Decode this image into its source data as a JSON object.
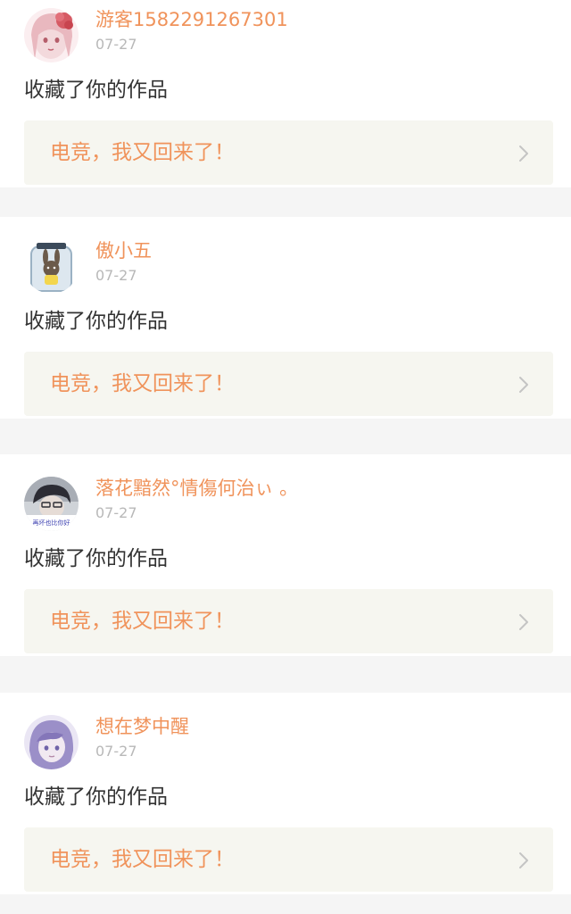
{
  "notifications": [
    {
      "username": "游客1582291267301",
      "date": "07-27",
      "action": "收藏了你的作品",
      "work_title": "电竞，我又回来了！",
      "avatar_icon": "anime-girl-red-flower-avatar-icon",
      "avatar_colors": [
        "#f3d9dc",
        "#d65a64",
        "#fbeef0"
      ]
    },
    {
      "username": "傲小五",
      "date": "07-27",
      "action": "收藏了你的作品",
      "work_title": "电竞，我又回来了！",
      "avatar_icon": "bunny-in-jar-avatar-icon",
      "avatar_colors": [
        "#dde7ef",
        "#6b5a4a",
        "#f3d64d"
      ]
    },
    {
      "username": "落花黯然°情傷何治ぃ 。",
      "date": "07-27",
      "action": "收藏了你的作品",
      "work_title": "电竞，我又回来了！",
      "avatar_icon": "boy-with-caption-avatar-icon",
      "avatar_colors": [
        "#cfd3d8",
        "#2c2c34",
        "#3b3fb0"
      ],
      "avatar_caption": "再坏也比你好"
    },
    {
      "username": "想在梦中醒",
      "date": "07-27",
      "action": "收藏了你的作品",
      "work_title": "电竞，我又回来了！",
      "avatar_icon": "purple-haired-girl-avatar-icon",
      "avatar_colors": [
        "#c9c3e3",
        "#9b8fc8",
        "#eae6f4"
      ]
    }
  ],
  "colors": {
    "accent": "#f0935b",
    "background": "#f5f5f5",
    "card": "#ffffff",
    "work_box": "#f6f6f0",
    "date": "#b8b8b8",
    "text": "#333333"
  }
}
